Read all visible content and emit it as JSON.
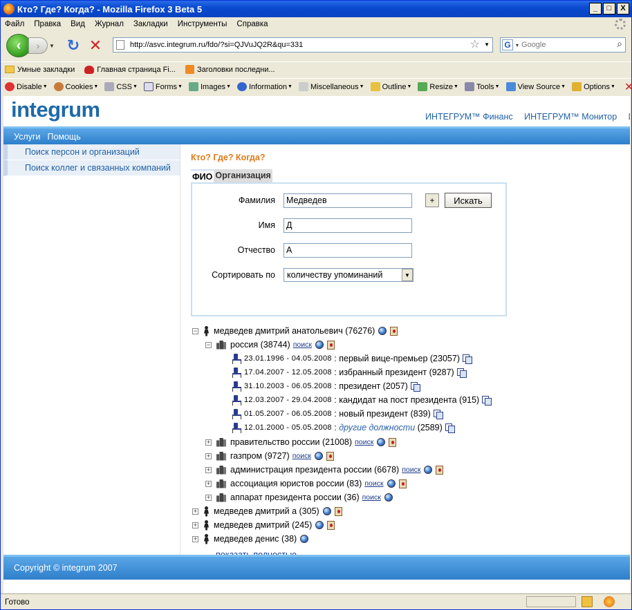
{
  "window": {
    "title": "Кто? Где? Когда? - Mozilla Firefox 3 Beta 5",
    "min": "_",
    "max": "□",
    "close": "X"
  },
  "menu": [
    "Файл",
    "Правка",
    "Вид",
    "Журнал",
    "Закладки",
    "Инструменты",
    "Справка"
  ],
  "nav": {
    "url": "http://asvc.integrum.ru/fdo/?si=QJVuJQ2R&qu=331",
    "search_placeholder": "Google",
    "search_engine": "G"
  },
  "bookmarks": [
    "Умные закладки",
    "Главная страница Fi...",
    "Заголовки последни..."
  ],
  "devtools": [
    "Disable",
    "Cookies",
    "CSS",
    "Forms",
    "Images",
    "Information",
    "Miscellaneous",
    "Outline",
    "Resize",
    "Tools",
    "View Source",
    "Options"
  ],
  "site": {
    "logo": "integrum",
    "toplinks": [
      "ИНТЕГРУМ™ Финанс",
      "ИНТЕГРУМ™ Монитор",
      "ИН"
    ],
    "nav": [
      "Услуги",
      "Помощь"
    ],
    "sidebar": [
      "Поиск персон и организаций",
      "Поиск коллег и связанных компаний"
    ],
    "page_title": "Кто? Где? Когда?",
    "tabs": [
      "ФИО",
      "Организация"
    ],
    "form": {
      "surname_label": "Фамилия",
      "surname_value": "Медведев",
      "name_label": "Имя",
      "name_value": "Д",
      "patronymic_label": "Отчество",
      "patronymic_value": "А",
      "sort_label": "Сортировать по",
      "sort_value": "количеству упоминаний",
      "plus_label": "+",
      "search_label": "Искать"
    },
    "search_link": "поиск",
    "tree": {
      "root": "медведев дмитрий анатольевич (76276)",
      "russia": "россия (38744)",
      "positions": [
        {
          "dates": "23.01.1996 - 04.05.2008",
          "text": ": первый вице-премьер (23057)"
        },
        {
          "dates": "17.04.2007 - 12.05.2008",
          "text": ": избранный президент (9287)"
        },
        {
          "dates": "31.10.2003 - 06.05.2008",
          "text": ": президент (2057)"
        },
        {
          "dates": "12.03.2007 - 29.04.2008",
          "text": ": кандидат на пост президента (915)"
        },
        {
          "dates": "01.05.2007 - 06.05.2008",
          "text": ": новый президент (839)"
        },
        {
          "dates": "12.01.2000 - 05.05.2008",
          "text": ":",
          "link": "другие должности",
          "count": "(2589)"
        }
      ],
      "orgs": [
        "правительство россии (21008)",
        "газпром (9727)",
        "администрация президента россии (6678)",
        "ассоциация юристов россии (83)",
        "аппарат президента россии (36)"
      ],
      "others": [
        "медведев дмитрий а (305)",
        "медведев дмитрий (245)",
        "медведев денис (38)"
      ],
      "show_all": "показать полностью"
    },
    "footer": "Copyright © integrum 2007"
  },
  "status": "Готово"
}
